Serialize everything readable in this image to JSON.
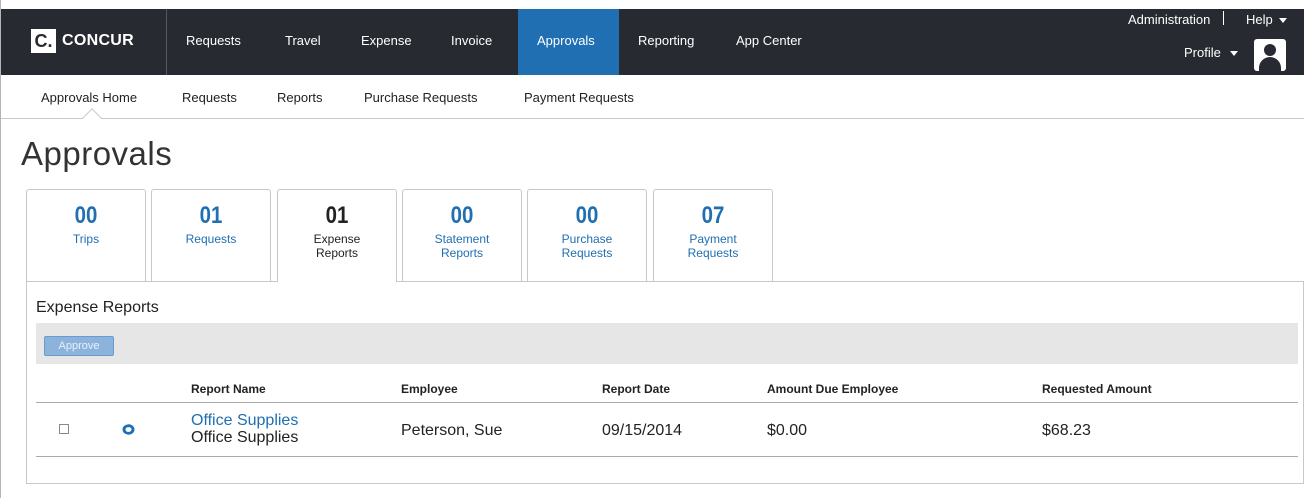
{
  "brand": {
    "logo_mark": "C.",
    "logo_text": "CONCUR"
  },
  "topnav": {
    "items": [
      {
        "label": "Requests"
      },
      {
        "label": "Travel"
      },
      {
        "label": "Expense"
      },
      {
        "label": "Invoice"
      },
      {
        "label": "Approvals",
        "active": true
      },
      {
        "label": "Reporting"
      },
      {
        "label": "App Center"
      }
    ],
    "administration": "Administration",
    "help": "Help",
    "profile": "Profile"
  },
  "subnav": {
    "items": [
      {
        "label": "Approvals Home",
        "active": true
      },
      {
        "label": "Requests"
      },
      {
        "label": "Reports"
      },
      {
        "label": "Purchase Requests"
      },
      {
        "label": "Payment Requests"
      }
    ]
  },
  "page_title": "Approvals",
  "tabs": [
    {
      "count": "00",
      "label_line1": "Trips",
      "label_line2": ""
    },
    {
      "count": "01",
      "label_line1": "Requests",
      "label_line2": ""
    },
    {
      "count": "01",
      "label_line1": "Expense",
      "label_line2": "Reports",
      "active": true
    },
    {
      "count": "00",
      "label_line1": "Statement",
      "label_line2": "Reports"
    },
    {
      "count": "00",
      "label_line1": "Purchase",
      "label_line2": "Requests"
    },
    {
      "count": "07",
      "label_line1": "Payment",
      "label_line2": "Requests"
    }
  ],
  "panel": {
    "title": "Expense Reports",
    "approve_label": "Approve",
    "columns": [
      "Report Name",
      "Employee",
      "Report Date",
      "Amount Due Employee",
      "Requested Amount"
    ],
    "rows": [
      {
        "report_name": "Office Supplies",
        "report_sub": "Office Supplies",
        "employee": "Peterson, Sue",
        "report_date": "09/15/2014",
        "amount_due": "$0.00",
        "requested_amount": "$68.23"
      }
    ]
  },
  "colors": {
    "nav_bg": "#272a30",
    "accent": "#1f6fb2",
    "toolbar_bg": "#e6e6e6"
  },
  "icons": {
    "comment": "comment-icon",
    "profile": "user-avatar-icon",
    "dropdown": "caret-down-icon"
  }
}
